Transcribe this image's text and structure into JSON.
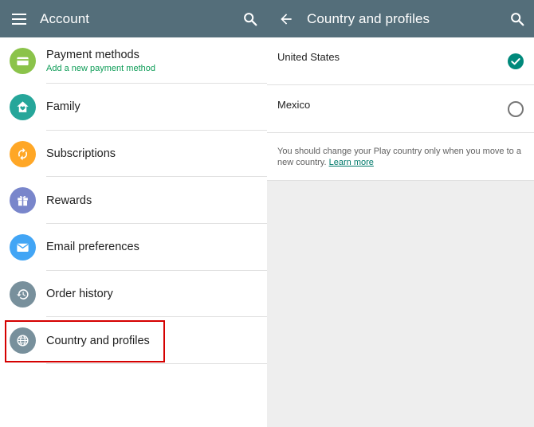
{
  "left": {
    "appbar_title": "Account",
    "menu_items": [
      {
        "label": "Payment methods",
        "sub": "Add a new payment method",
        "color": "#8bc34a",
        "icon": "credit-card-icon"
      },
      {
        "label": "Family",
        "color": "#26a69a",
        "icon": "family-home-icon"
      },
      {
        "label": "Subscriptions",
        "color": "#ffa726",
        "icon": "sync-icon"
      },
      {
        "label": "Rewards",
        "color": "#7986cb",
        "icon": "gift-icon"
      },
      {
        "label": "Email preferences",
        "color": "#42a5f5",
        "icon": "mail-icon"
      },
      {
        "label": "Order history",
        "color": "#78909c",
        "icon": "history-icon"
      },
      {
        "label": "Country and profiles",
        "color": "#78909c",
        "icon": "globe-icon"
      }
    ]
  },
  "right": {
    "appbar_title": "Country and profiles",
    "countries": [
      {
        "name": "United States",
        "selected": true
      },
      {
        "name": "Mexico",
        "selected": false
      }
    ],
    "note_text": "You should change your Play country only when you move to a new country.",
    "note_link": "Learn more"
  },
  "colors": {
    "appbar": "#546e7a",
    "accent": "#00897b",
    "highlight": "#d50000"
  }
}
